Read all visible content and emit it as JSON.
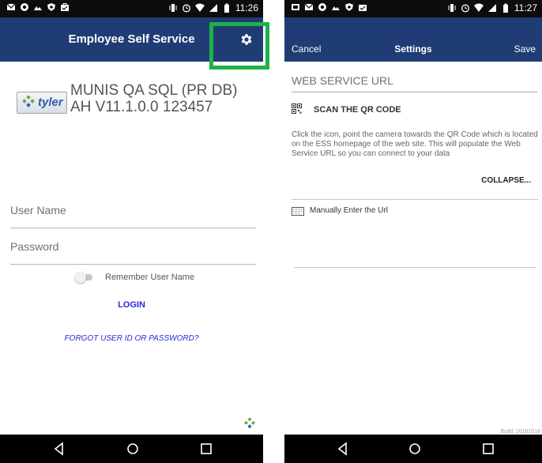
{
  "login_screen": {
    "status_time": "11:26",
    "app_title": "Employee Self Service",
    "brand_logo_text": "tyler",
    "brand_line1": "MUNIS QA SQL (PR DB)",
    "brand_line2": "AH V11.1.0.0 123457",
    "username_placeholder": "User Name",
    "password_placeholder": "Password",
    "remember_label": "Remember User Name",
    "remember_checked": false,
    "login_label": "LOGIN",
    "forgot_label": "FORGOT USER ID OR PASSWORD?"
  },
  "settings_screen": {
    "status_time": "11:27",
    "cancel_label": "Cancel",
    "title": "Settings",
    "save_label": "Save",
    "ws_url_placeholder": "WEB SERVICE URL",
    "scan_label": "SCAN THE QR CODE",
    "instructions": "Click the icon, point the camera towards the QR Code which is located on the ESS homepage of the web site. This will populate the Web Service URL so you can connect to your data",
    "collapse_label": "COLLAPSE...",
    "manual_label": "Manually Enter the Url",
    "build": "Build: 20161018"
  },
  "colors": {
    "header_bg": "#1f3d74",
    "link_blue": "#2b29d9",
    "highlight_green": "#1fb04a"
  },
  "icons": {
    "status_bar": [
      "mail-icon",
      "record-icon",
      "photo-icon",
      "shield-icon",
      "bag-icon"
    ],
    "status_right": [
      "vibrate-icon",
      "alarm-icon",
      "wifi-icon",
      "signal-icon",
      "battery-icon"
    ],
    "nav": [
      "back-icon",
      "home-icon",
      "recents-icon"
    ]
  }
}
